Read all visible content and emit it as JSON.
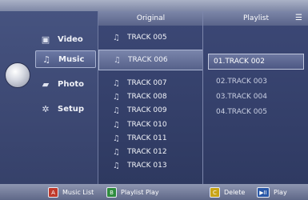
{
  "menu": {
    "items": [
      {
        "label": "Video",
        "icon": "film-icon",
        "active": false
      },
      {
        "label": "Music",
        "icon": "music-note-icon",
        "active": true
      },
      {
        "label": "Photo",
        "icon": "photo-icon",
        "active": false
      },
      {
        "label": "Setup",
        "icon": "gear-icon",
        "active": false
      }
    ]
  },
  "original": {
    "header": "Original",
    "tracks": [
      "TRACK 005",
      "TRACK 006",
      "TRACK 007",
      "TRACK 008",
      "TRACK 009",
      "TRACK 010",
      "TRACK 011",
      "TRACK 012",
      "TRACK 013"
    ],
    "selected_index": 1
  },
  "playlist": {
    "header": "Playlist",
    "items": [
      "01.TRACK 002",
      "02.TRACK 003",
      "03.TRACK 004",
      "04.TRACK 005"
    ],
    "selected_index": 0
  },
  "bottom": {
    "buttons": [
      {
        "key": "A",
        "label": "Music List",
        "color": "#c0392b"
      },
      {
        "key": "B",
        "label": "Playlist Play",
        "color": "#2e8b3e"
      },
      {
        "key": "C",
        "label": "Delete",
        "color": "#c9a416"
      },
      {
        "key": "▶II",
        "label": "Play",
        "color": "#2a58a8"
      }
    ]
  }
}
